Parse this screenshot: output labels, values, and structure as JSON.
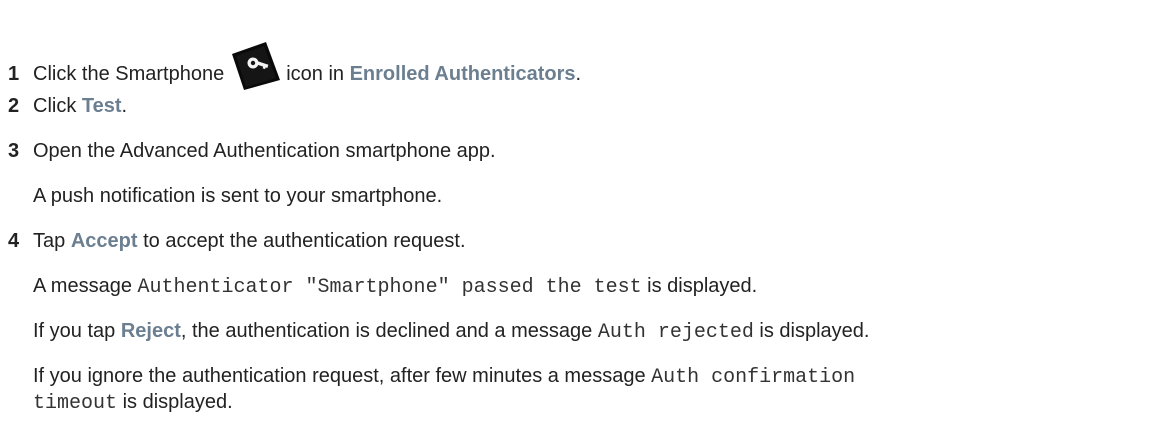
{
  "steps": [
    {
      "number": "1",
      "before": "Click the Smartphone",
      "icon": "smartphone-key-icon",
      "middle": "icon in",
      "ui_term": "Enrolled Authenticators",
      "after": "."
    },
    {
      "number": "2",
      "before": "Click",
      "ui_term": "Test",
      "after": "."
    },
    {
      "number": "3",
      "text": "Open the Advanced Authentication smartphone app.",
      "result": "A push notification is sent to your smartphone."
    },
    {
      "number": "4",
      "before": "Tap",
      "ui_term": "Accept",
      "after": "to accept the authentication request.",
      "result_before": "A message",
      "result_code": "Authenticator \"Smartphone\" passed the test",
      "result_after": "is displayed.",
      "reject_before": "If you tap",
      "reject_term": "Reject",
      "reject_middle": ", the authentication is declined and a message",
      "reject_code": "Auth rejected",
      "reject_after": "is displayed.",
      "ignore_before": "If you ignore the authentication request, after few minutes a message",
      "ignore_code_1": "Auth confirmation",
      "ignore_code_2": "timeout",
      "ignore_after": "is displayed."
    }
  ]
}
